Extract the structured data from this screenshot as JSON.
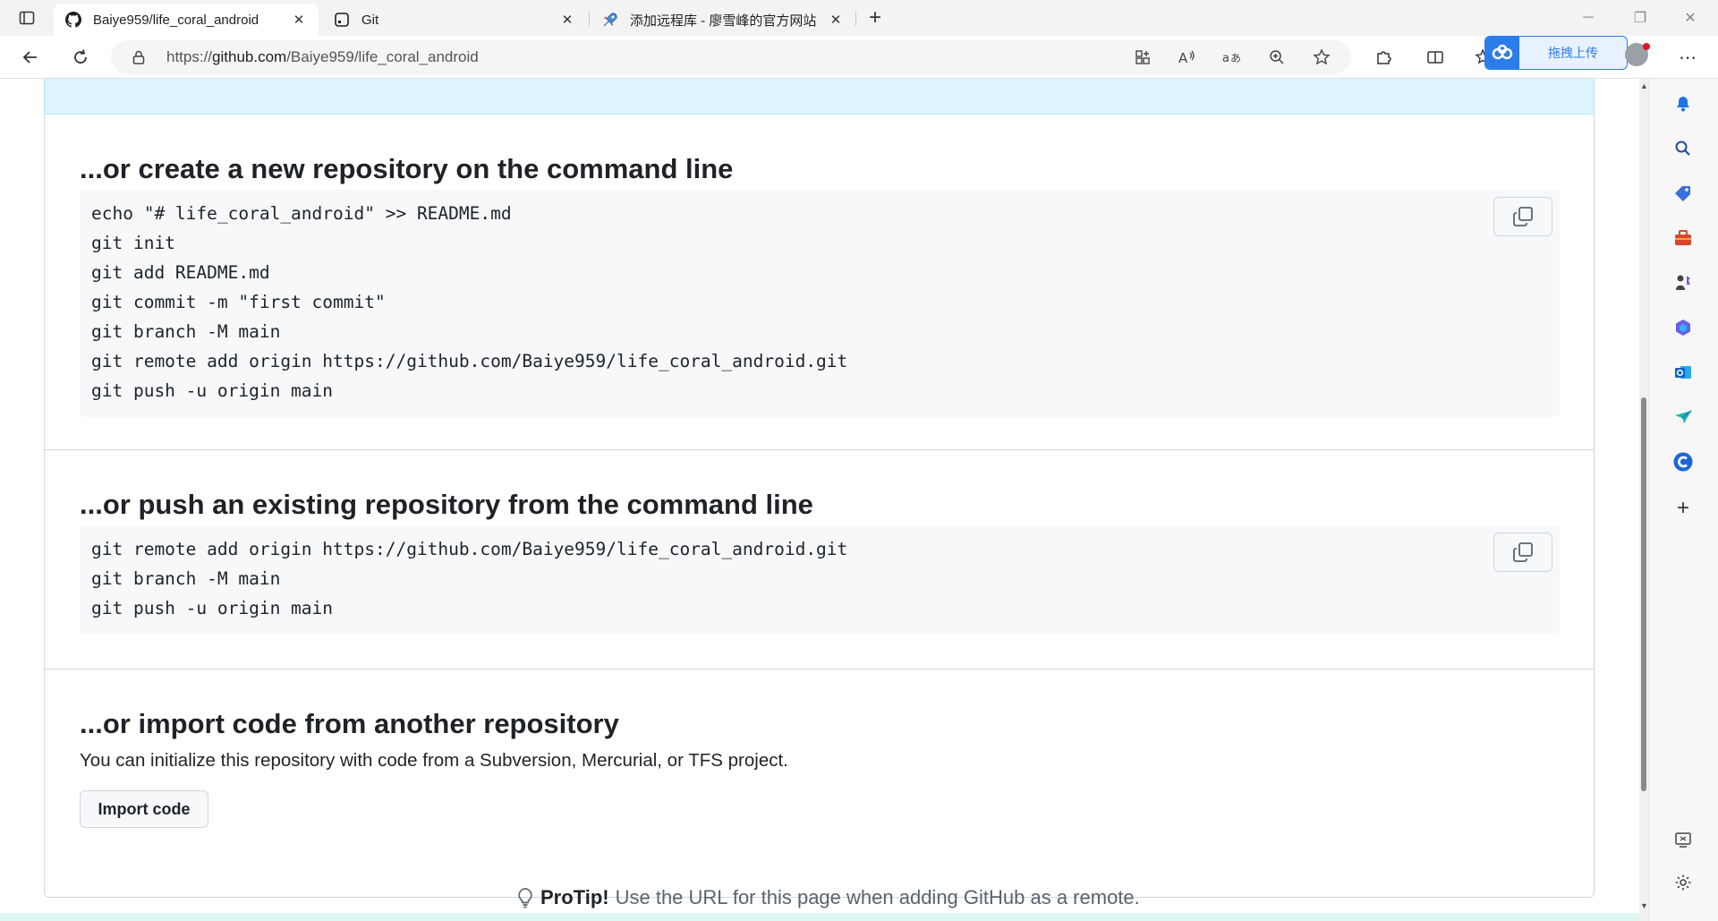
{
  "browser": {
    "tabs": [
      {
        "title": "Baiye959/life_coral_android",
        "favicon": "github-icon",
        "active": true
      },
      {
        "title": "Git",
        "favicon": "terminal-icon",
        "active": false
      },
      {
        "title": "添加远程库 - 廖雪峰的官方网站",
        "favicon": "rocket-icon",
        "active": false
      }
    ],
    "close_glyph": "✕",
    "new_tab_glyph": "+",
    "window_controls": {
      "minimize": "─",
      "restore": "❐",
      "close": "✕"
    },
    "address": {
      "prefix": "https://",
      "host": "github.com",
      "path": "/Baiye959/life_coral_android"
    },
    "baidu_upload_label": "拖拽上传",
    "menu_glyph": "⋯"
  },
  "page": {
    "sections": [
      {
        "title": "...or create a new repository on the command line",
        "code": [
          "echo \"# life_coral_android\" >> README.md",
          "git init",
          "git add README.md",
          "git commit -m \"first commit\"",
          "git branch -M main",
          "git remote add origin https://github.com/Baiye959/life_coral_android.git",
          "git push -u origin main"
        ]
      },
      {
        "title": "...or push an existing repository from the command line",
        "code": [
          "git remote add origin https://github.com/Baiye959/life_coral_android.git",
          "git branch -M main",
          "git push -u origin main"
        ]
      },
      {
        "title": "...or import code from another repository",
        "description": "You can initialize this repository with code from a Subversion, Mercurial, or TFS project.",
        "button": "Import code"
      }
    ],
    "protip": {
      "label": "ProTip!",
      "text": "Use the URL for this page when adding GitHub as a remote."
    }
  },
  "colors": {
    "accent": "#0969da",
    "banner": "#ddf4ff",
    "code_bg": "#f6f8fa",
    "border": "#d0d7de"
  }
}
